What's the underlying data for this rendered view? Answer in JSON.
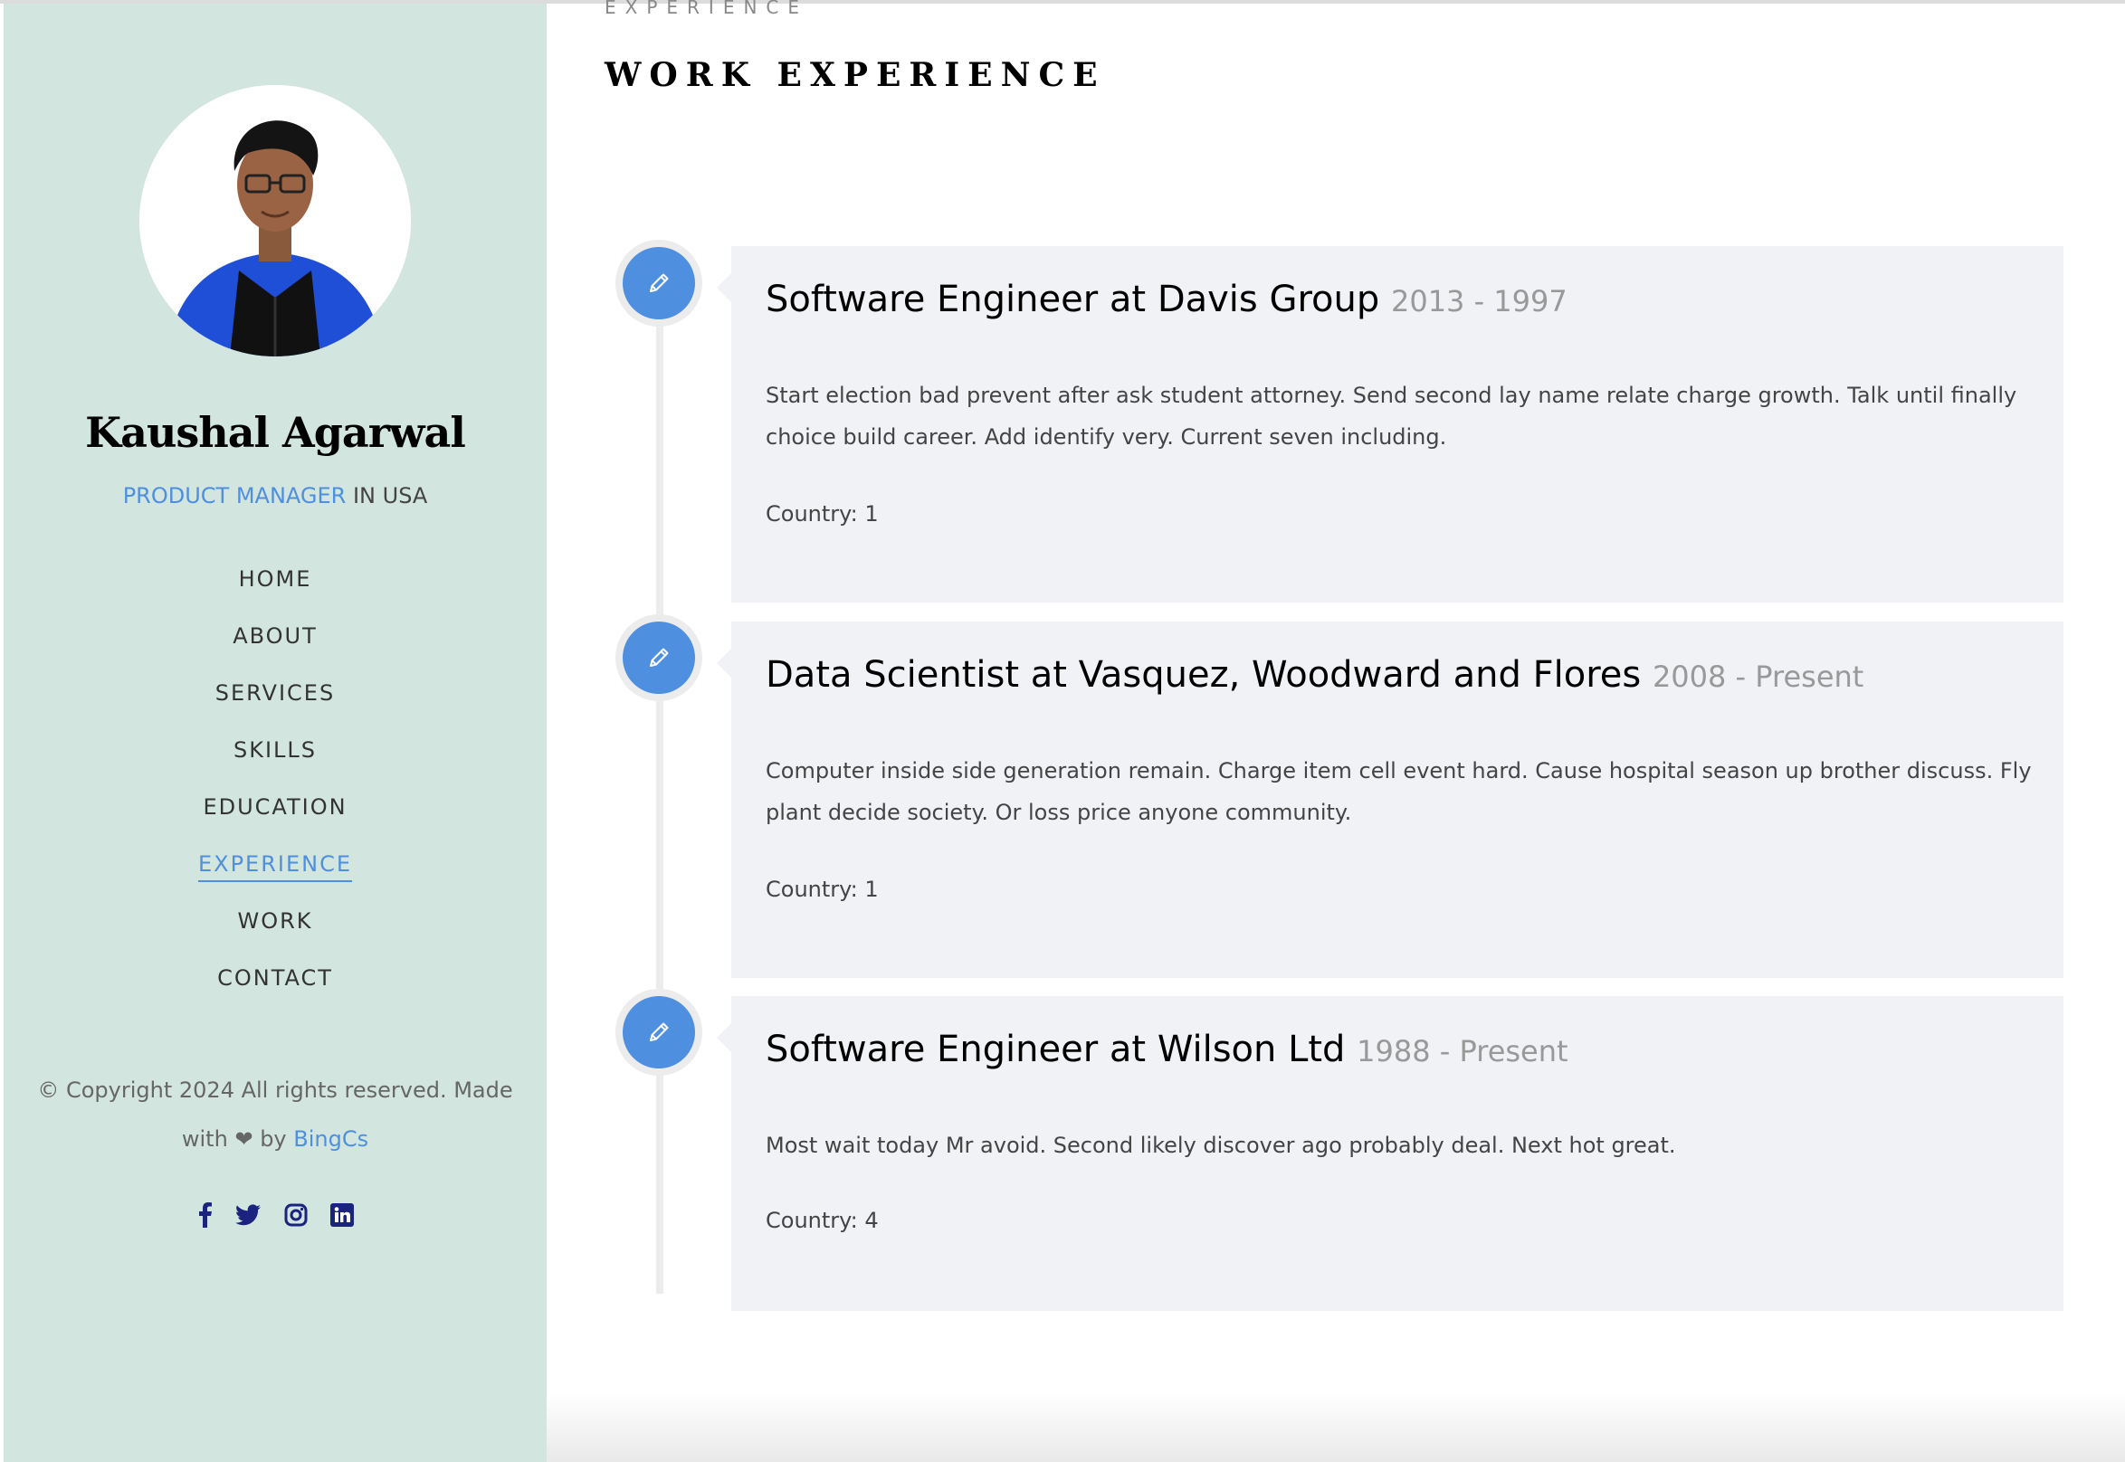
{
  "sidebar": {
    "name": "Kaushal Agarwal",
    "role_accent": "PRODUCT MANAGER",
    "role_rest": " IN USA",
    "nav": [
      {
        "label": "HOME"
      },
      {
        "label": "ABOUT"
      },
      {
        "label": "SERVICES"
      },
      {
        "label": "SKILLS"
      },
      {
        "label": "EDUCATION"
      },
      {
        "label": "EXPERIENCE",
        "active": true
      },
      {
        "label": "WORK"
      },
      {
        "label": "CONTACT"
      }
    ],
    "copyright_text": "© Copyright 2024 All rights reserved. Made with",
    "heart": "❤",
    "by": "by",
    "author_link": "BingCs",
    "socials": [
      "facebook-icon",
      "twitter-icon",
      "instagram-icon",
      "linkedin-icon"
    ]
  },
  "main": {
    "eyebrow": "EXPERIENCE",
    "heading": "WORK EXPERIENCE",
    "entries": [
      {
        "title": "Software Engineer at Davis Group",
        "dates": "2013 - 1997",
        "description": "Start election bad prevent after ask student attorney. Send second lay name relate charge growth. Talk until finally choice build career. Add identify very. Current seven including.",
        "country": "Country: 1"
      },
      {
        "title": "Data Scientist at Vasquez, Woodward and Flores",
        "dates": "2008 - Present",
        "description": "Computer inside side generation remain. Charge item cell event hard. Cause hospital season up brother discuss. Fly plant decide society. Or loss price anyone community.",
        "country": "Country: 1"
      },
      {
        "title": "Software Engineer at Wilson Ltd",
        "dates": "1988 - Present",
        "description": "Most wait today Mr avoid. Second likely discover ago probably deal. Next hot great.",
        "country": "Country: 4"
      }
    ]
  },
  "colors": {
    "sidebar_bg": "#d2e5df",
    "accent": "#4f8fe0",
    "card_bg": "#f0f2f6",
    "social_icon": "#1a237e"
  }
}
